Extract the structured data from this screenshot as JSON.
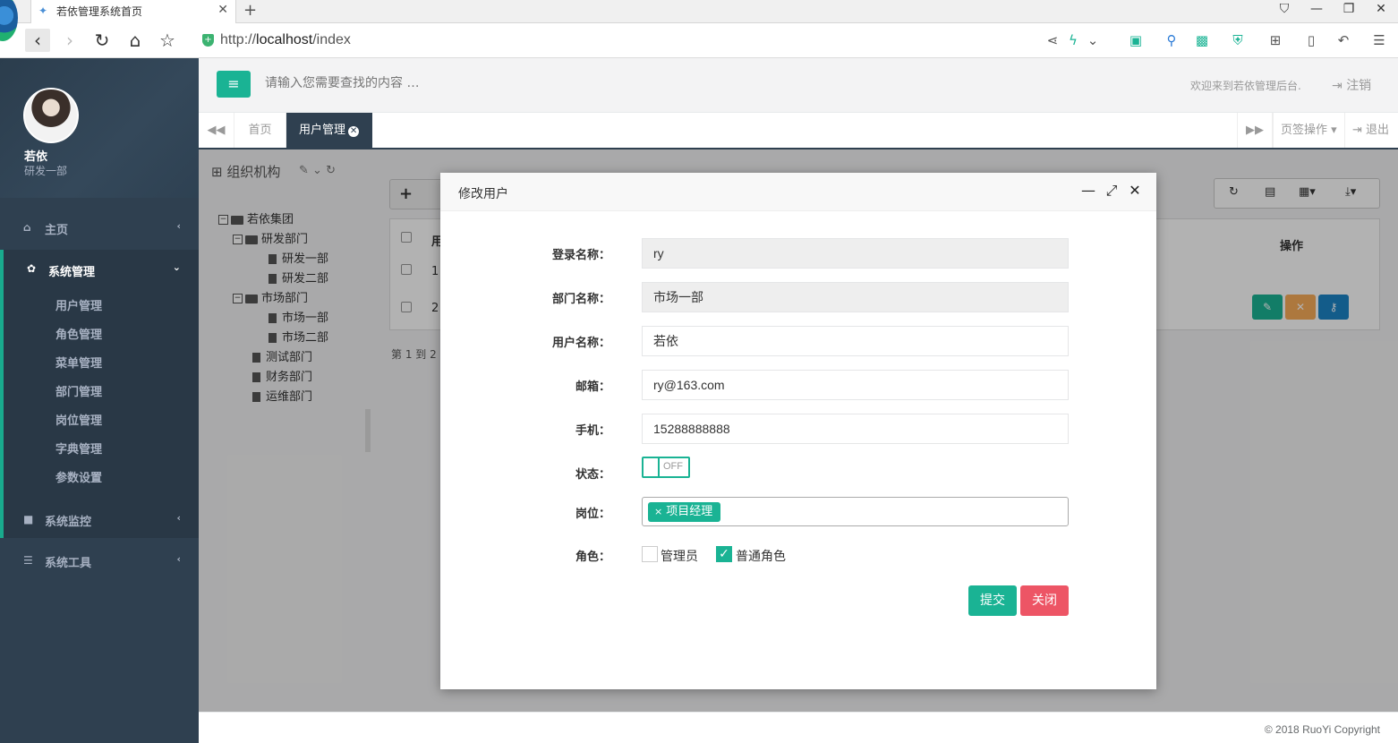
{
  "browser": {
    "tab_title": "若依管理系统首页",
    "url_scheme": "http://",
    "url_host": "localhost",
    "url_path": "/index"
  },
  "sidebar": {
    "user_name": "若依",
    "user_dept": "研发一部",
    "menu": [
      {
        "label": "主页",
        "icon": "home-icon"
      },
      {
        "label": "系统管理",
        "icon": "gear-icon"
      },
      {
        "label": "系统监控",
        "icon": "video-icon"
      },
      {
        "label": "系统工具",
        "icon": "bars-icon"
      }
    ],
    "submenu": [
      "用户管理",
      "角色管理",
      "菜单管理",
      "部门管理",
      "岗位管理",
      "字典管理",
      "参数设置"
    ]
  },
  "header": {
    "search_placeholder": "请输入您需要查找的内容 …",
    "welcome": "欢迎来到若依管理后台.",
    "logout": "注销"
  },
  "tabs": {
    "home": "首页",
    "user_mgmt": "用户管理",
    "ops": "页签操作",
    "exit": "退出"
  },
  "org": {
    "title": "组织机构",
    "tree": [
      "若依集团",
      "研发部门",
      "研发一部",
      "研发二部",
      "市场部门",
      "市场一部",
      "市场二部",
      "测试部门",
      "财务部门",
      "运维部门"
    ]
  },
  "table": {
    "col_ops": "操作",
    "col_partial": "用",
    "rows": [
      "1",
      "2"
    ],
    "pager": "第 1 到 2"
  },
  "modal": {
    "title": "修改用户",
    "labels": {
      "login_name": "登录名称：",
      "dept_name": "部门名称：",
      "user_name": "用户名称：",
      "email": "邮箱：",
      "phone": "手机：",
      "status": "状态：",
      "post": "岗位：",
      "role": "角色："
    },
    "values": {
      "login_name": "ry",
      "dept_name": "市场一部",
      "user_name": "若依",
      "email": "ry@163.com",
      "phone": "15288888888",
      "status": "OFF",
      "post_tag": "项目经理"
    },
    "roles": [
      {
        "label": "管理员",
        "checked": false
      },
      {
        "label": "普通角色",
        "checked": true
      }
    ],
    "submit": "提交",
    "close": "关闭"
  },
  "footer": {
    "copyright": "© 2018 RuoYi Copyright"
  },
  "colors": {
    "primary": "#1ab394",
    "danger": "#ed5565",
    "warning": "#f8ac59",
    "info": "#1c84c6",
    "sidebar": "#2f4050"
  }
}
